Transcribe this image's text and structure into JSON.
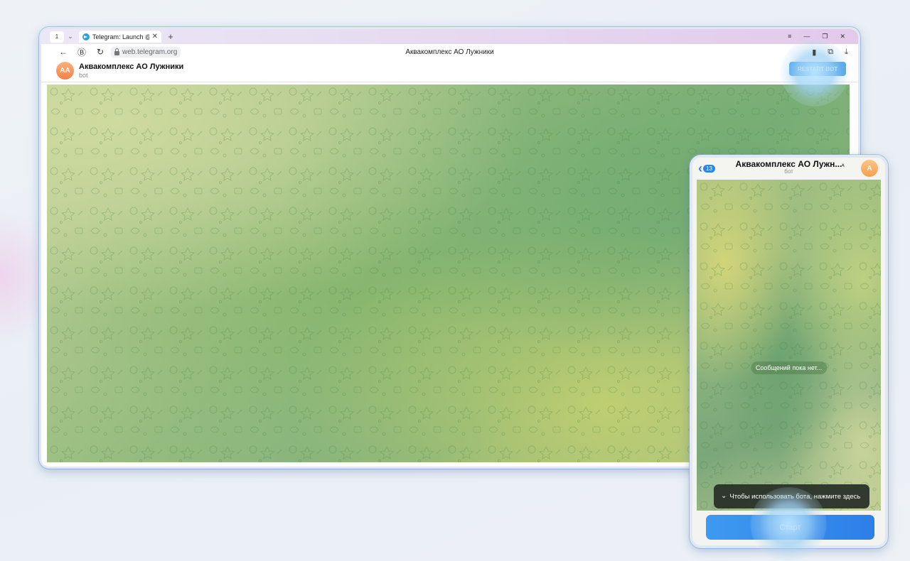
{
  "browser": {
    "tab_count": "1",
    "tab_title": "Telegram: Launch @ac",
    "url": "web.telegram.org",
    "page_title": "Аквакомплекс АО Лужники"
  },
  "web_chat": {
    "avatar_initials": "АА",
    "title": "Аквакомплекс АО Лужники",
    "subtitle": "bot",
    "restart_label": "RESTART BOT"
  },
  "mobile_chat": {
    "back_count": "13",
    "title": "Аквакомплекс АО Лужн...",
    "subtitle": "бот",
    "avatar_initial": "А",
    "empty_text": "Сообщений пока нет...",
    "hint_text": "Чтобы использовать бота, нажмите здесь",
    "start_label": "Старт"
  },
  "colors": {
    "accent": "#3d9bea",
    "chat_bg": "#8cb37e",
    "avatar": "#f5804a"
  },
  "icons": [
    "telegram-icon",
    "back-icon",
    "forward-icon",
    "reload-icon",
    "lock-icon",
    "bookmark-icon",
    "extensions-icon",
    "download-icon",
    "menu-icon",
    "minimize-icon",
    "maximize-icon",
    "close-icon",
    "mute-icon",
    "chevron-double-down-icon"
  ]
}
